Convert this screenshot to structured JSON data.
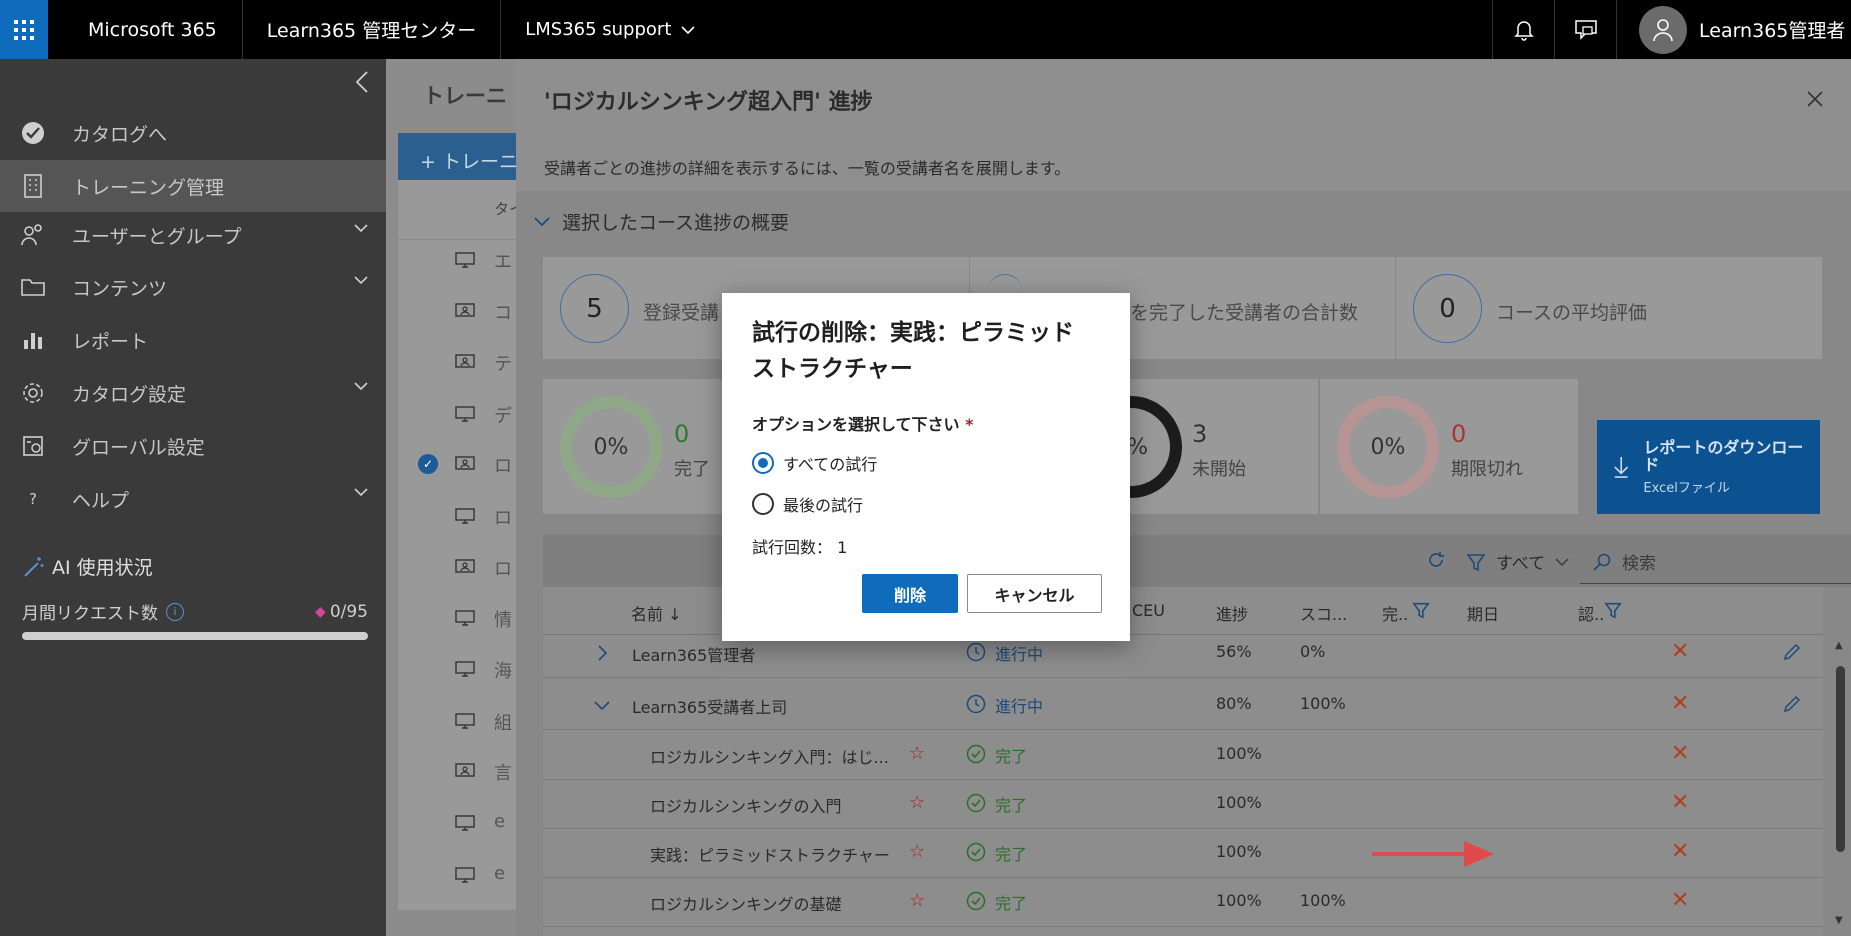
{
  "topbar": {
    "app_name": "Microsoft 365",
    "admin_center": "Learn365 管理センター",
    "tenant": "LMS365 support",
    "user_name": "Learn365管理者"
  },
  "sidebar": {
    "items": [
      {
        "label": "カタログへ",
        "icon": "check-circle-icon"
      },
      {
        "label": "トレーニング管理",
        "icon": "building-icon"
      },
      {
        "label": "ユーザーとグループ",
        "icon": "users-icon"
      },
      {
        "label": "コンテンツ",
        "icon": "folder-icon"
      },
      {
        "label": "レポート",
        "icon": "bar-chart-icon"
      },
      {
        "label": "カタログ設定",
        "icon": "gear-icon"
      },
      {
        "label": "グローバル設定",
        "icon": "global-settings-icon"
      },
      {
        "label": "ヘルプ",
        "icon": "question-icon"
      }
    ],
    "ai_usage_title": "AI 使用状況",
    "monthly_requests_label": "月間リクエスト数",
    "monthly_requests_value": "0/95",
    "monthly_requests_fraction": 0.0
  },
  "midlist": {
    "title": "トレーニ",
    "new_button": "+ トレーニ",
    "col_type": "タイ",
    "rows": [
      "エ",
      "コ",
      "テ",
      "デ",
      "ロ",
      "ロ",
      "ロ",
      "情",
      "海",
      "組",
      "言",
      "e",
      "e"
    ]
  },
  "panel": {
    "title": "'ロジカルシンキング超入門' 進捗",
    "description": "受講者ごとの進捗の詳細を表示するには、一覧の受講者名を展開します。",
    "overview_label": "選択したコース進捗の概要",
    "stats": [
      {
        "value": "5",
        "label": "登録受講"
      },
      {
        "value": "",
        "label": "を完了した受講者の合計数"
      },
      {
        "value": "0",
        "label": "コースの平均評価"
      }
    ],
    "rings": [
      {
        "pct": "0%",
        "count": "0",
        "label": "完了"
      },
      {
        "pct": "%",
        "count": "3",
        "label": "未開始"
      },
      {
        "pct": "0%",
        "count": "0",
        "label": "期限切れ"
      }
    ],
    "download_title": "レポートのダウンロード",
    "download_sub": "Excelファイル",
    "filter_label": "すべて",
    "search_placeholder": "検索",
    "columns": {
      "name": "名前 ↓",
      "ceu": "CEU",
      "progress": "進捗",
      "score": "スコ...",
      "complete": "完..",
      "due": "期日",
      "cert": "認.."
    },
    "rows": [
      {
        "name": "Learn365管理者",
        "status": "進行中",
        "progress": "56%",
        "score": "0%"
      },
      {
        "name": "Learn365受講者上司",
        "status": "進行中",
        "progress": "80%",
        "score": "100%"
      },
      {
        "name": "ロジカルシンキング入門：はじ...",
        "status": "完了",
        "progress": "100%",
        "score": ""
      },
      {
        "name": "ロジカルシンキングの入門",
        "status": "完了",
        "progress": "100%",
        "score": ""
      },
      {
        "name": "実践：ピラミッドストラクチャー",
        "status": "完了",
        "progress": "100%",
        "score": ""
      },
      {
        "name": "ロジカルシンキングの基礎",
        "status": "完了",
        "progress": "100%",
        "score": "100%"
      }
    ]
  },
  "dialog": {
    "title": "試行の削除：実践：ピラミッドストラクチャー",
    "option_label": "オプションを選択して下さい",
    "required_mark": "*",
    "option_all": "すべての試行",
    "option_last": "最後の試行",
    "attempt_count": "試行回数： 1",
    "delete_button": "削除",
    "cancel_button": "キャンセル"
  },
  "colors": {
    "accent": "#0f6cbd",
    "danger": "#b04020",
    "arrow": "#e04a4a"
  }
}
